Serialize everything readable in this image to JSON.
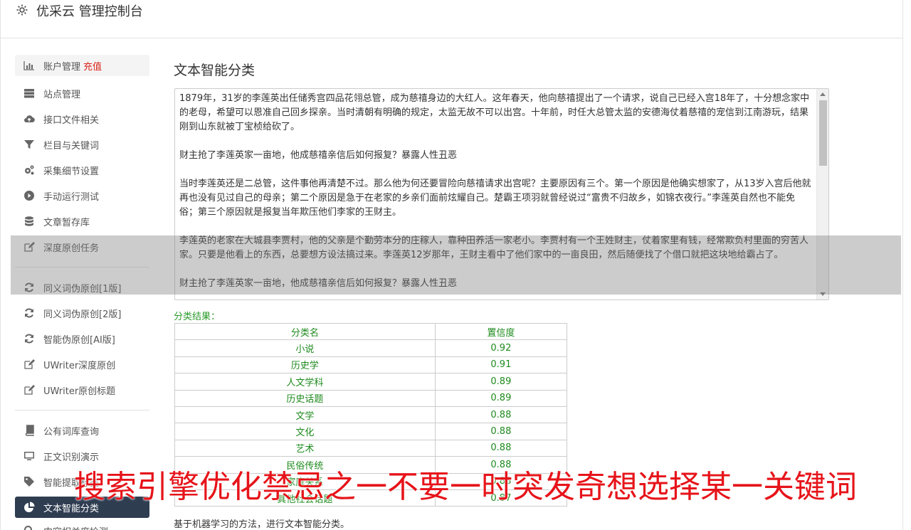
{
  "header": {
    "title": "优采云 管理控制台",
    "icon": "gear-icon"
  },
  "sidebar": {
    "groups": [
      [
        {
          "label": "账户管理",
          "badge": "充值",
          "icon": "bar-chart-icon"
        },
        {
          "label": "站点管理",
          "icon": "server-icon"
        },
        {
          "label": "接口文件相关",
          "icon": "cloud-upload-icon"
        },
        {
          "label": "栏目与关键词",
          "icon": "filter-icon"
        },
        {
          "label": "采集细节设置",
          "icon": "gears-icon"
        },
        {
          "label": "手动运行测试",
          "icon": "play-icon"
        },
        {
          "label": "文章暂存库",
          "icon": "database-icon"
        },
        {
          "label": "深度原创任务",
          "icon": "edit-icon"
        }
      ],
      [
        {
          "label": "同义词伪原创[1版]",
          "icon": "refresh-icon"
        },
        {
          "label": "同义词伪原创[2版]",
          "icon": "refresh-icon"
        },
        {
          "label": "智能伪原创[AI版]",
          "icon": "refresh-icon"
        },
        {
          "label": "UWriter深度原创",
          "icon": "edit-icon"
        },
        {
          "label": "UWriter原创标题",
          "icon": "edit-icon"
        }
      ],
      [
        {
          "label": "公有词库查询",
          "icon": "book-icon"
        },
        {
          "label": "正文识别演示",
          "icon": "monitor-icon"
        },
        {
          "label": "智能提取标签",
          "icon": "tag-icon"
        },
        {
          "label": "文本智能分类",
          "icon": "pie-chart-icon",
          "active": true
        },
        {
          "label": "内容相关度检测",
          "icon": "search-icon"
        }
      ]
    ]
  },
  "main": {
    "title": "文本智能分类",
    "text_paragraphs": [
      "1879年，31岁的李莲英出任储秀宫四品花翎总管，成为慈禧身边的大红人。这年春天，他向慈禧提出了一个请求，说自己已经入宫18年了，十分想念家中的老母，希望可以恩准自己回乡探亲。当时清朝有明确的规定，太监无故不可以出宫。十年前，时任大总管太监的安德海仗着慈禧的宠信到江南游玩，结果刚到山东就被丁宝桢给砍了。",
      "财主抢了李莲英家一亩地，他成慈禧亲信后如何报复？暴露人性丑恶",
      "当时李莲英还是二总管，这件事他再清楚不过。那么他为何还要冒险向慈禧请求出宫呢？主要原因有三个。第一个原因是他确实想家了，从13岁入宫后他就再也没有见过自己的母亲；第二个原因是急于在老家的乡亲们面前炫耀自己。楚霸王项羽就曾经说过“富贵不归故乡，如锦衣夜行。”李莲英自然也不能免俗；第三个原因就是报复当年欺压他们李家的王财主。",
      "李莲英的老家在大城县李贾村，他的父亲是个勤劳本分的庄稼人，靠种田养活一家老小。李贾村有一个王姓财主，仗着家里有钱，经常欺负村里面的穷苦人家。只要是他看上的东西，总要想方设法搞过来。李莲英12岁那年，王财主看中了他们家中的一亩良田，然后随便找了个借口就把这块地给霸占了。",
      "财主抢了李莲英家一亩地，他成慈禧亲信后如何报复？暴露人性丑恶"
    ],
    "result_label": "分类结果：",
    "table_headers": [
      "分类名",
      "置信度"
    ],
    "results": [
      [
        "小说",
        "0.92"
      ],
      [
        "历史学",
        "0.91"
      ],
      [
        "人文学科",
        "0.89"
      ],
      [
        "历史话题",
        "0.89"
      ],
      [
        "文学",
        "0.88"
      ],
      [
        "文化",
        "0.88"
      ],
      [
        "艺术",
        "0.88"
      ],
      [
        "民俗传统",
        "0.88"
      ],
      [
        "家庭关系",
        "0.88"
      ],
      [
        "其他社会话题",
        "0.87"
      ]
    ],
    "footnote": "基于机器学习的方法，进行文本智能分类。"
  },
  "banner": "搜索引擎优化禁忌之一不要一时突发奇想选择某一关键词"
}
